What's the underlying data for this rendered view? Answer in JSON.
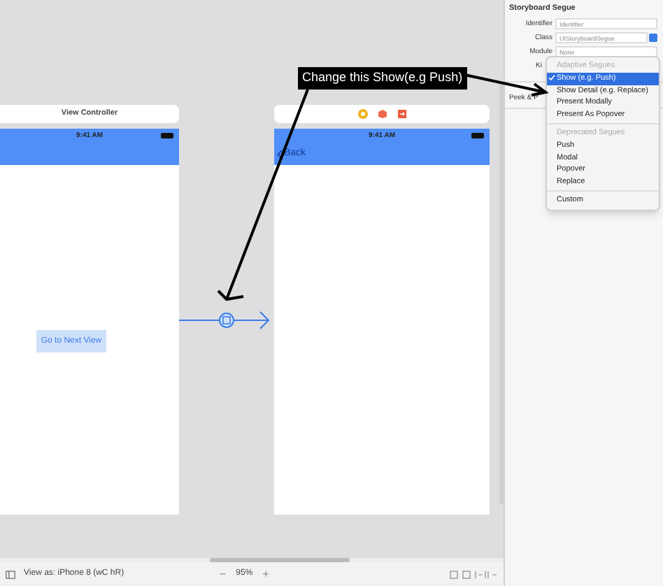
{
  "canvas": {
    "source_scene": {
      "title": "View Controller",
      "status_time": "9:41 AM",
      "button": "Go to Next View"
    },
    "destination_scene": {
      "status_time": "9:41 AM",
      "back": "Back"
    },
    "annotation": "Change this Show(e.g Push)"
  },
  "inspector": {
    "title": "Storyboard Segue",
    "fields": [
      {
        "label": "Identifier",
        "placeholder": "Identifier",
        "kind": "text"
      },
      {
        "label": "Class",
        "placeholder": "UIStoryboardSegue",
        "kind": "class"
      },
      {
        "label": "Module",
        "placeholder": "None",
        "kind": "select"
      }
    ],
    "kind_label": "Ki",
    "peek_label": "Peek & P",
    "menu": [
      {
        "kind": "header",
        "label": "Adaptive Segues"
      },
      {
        "kind": "item",
        "label": "Show (e.g. Push)",
        "selected": true
      },
      {
        "kind": "item",
        "label": "Show Detail (e.g. Replace)",
        "selected": false
      },
      {
        "kind": "item",
        "label": "Present Modally",
        "selected": false
      },
      {
        "kind": "item",
        "label": "Present As Popover",
        "selected": false
      },
      {
        "kind": "separator"
      },
      {
        "kind": "header",
        "label": "Deprecated Segues"
      },
      {
        "kind": "item",
        "label": "Push",
        "selected": false
      },
      {
        "kind": "item",
        "label": "Modal",
        "selected": false
      },
      {
        "kind": "item",
        "label": "Popover",
        "selected": false
      },
      {
        "kind": "item",
        "label": "Replace",
        "selected": false
      },
      {
        "kind": "separator"
      },
      {
        "kind": "item",
        "label": "Custom",
        "selected": false
      }
    ]
  },
  "bottom_bar": {
    "view_as": "View as: iPhone 8 (wC hR)",
    "zoom_out": "−",
    "zoom": "95%",
    "zoom_in": "+"
  }
}
